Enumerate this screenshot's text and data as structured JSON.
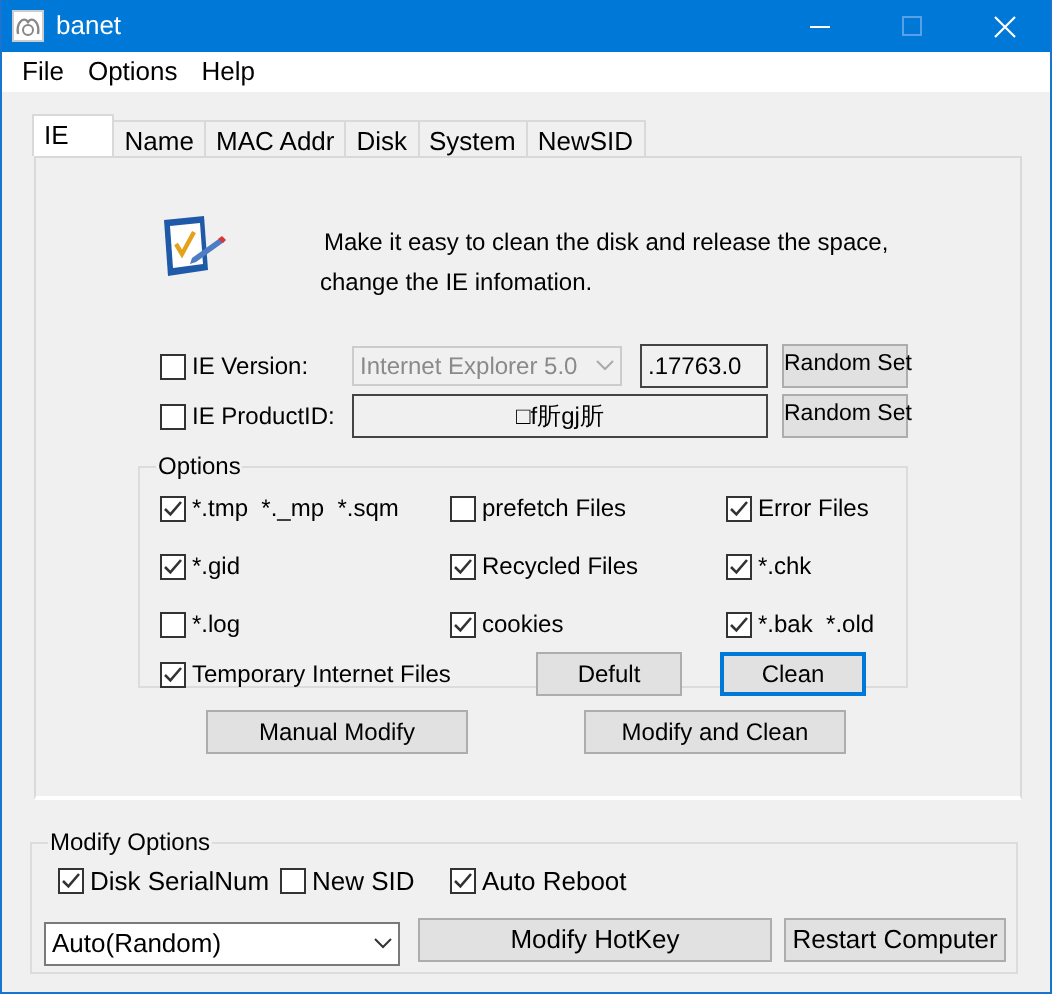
{
  "window": {
    "title": "banet"
  },
  "menu": [
    "File",
    "Options",
    "Help"
  ],
  "tabs": [
    {
      "label": "IE",
      "selected": true
    },
    {
      "label": "Name",
      "selected": false
    },
    {
      "label": "MAC Addr",
      "selected": false
    },
    {
      "label": "Disk",
      "selected": false
    },
    {
      "label": "System",
      "selected": false
    },
    {
      "label": "NewSID",
      "selected": false
    }
  ],
  "ie_panel": {
    "description": [
      "Make it easy to clean the disk and release the space,",
      "change the IE infomation."
    ],
    "ie_version": {
      "label": "IE Version:",
      "checked": false,
      "combo": {
        "value": "Internet Explorer 5.0",
        "disabled": true
      },
      "build": ".17763.0",
      "button": "Random Set"
    },
    "product_id": {
      "label": "IE ProductID:",
      "checked": false,
      "value": "□f肵gj肵",
      "button": "Random Set"
    },
    "options": {
      "title": "Options",
      "items": [
        {
          "label": "*.tmp  *._mp  *.sqm",
          "checked": true
        },
        {
          "label": "prefetch Files",
          "checked": false
        },
        {
          "label": "Error Files",
          "checked": true
        },
        {
          "label": "*.gid",
          "checked": true
        },
        {
          "label": "Recycled Files",
          "checked": true
        },
        {
          "label": "*.chk",
          "checked": true
        },
        {
          "label": "*.log",
          "checked": false
        },
        {
          "label": "cookies",
          "checked": true
        },
        {
          "label": "*.bak  *.old",
          "checked": true
        },
        {
          "label": "Temporary Internet Files",
          "checked": true
        }
      ],
      "buttons": [
        {
          "label": "Defult",
          "focused": false
        },
        {
          "label": "Clean",
          "focused": true
        }
      ]
    },
    "buttons": [
      "Manual Modify",
      "Modify and Clean"
    ]
  },
  "modify_options": {
    "title": "Modify Options",
    "checks": [
      {
        "label": "Disk SerialNum",
        "checked": true
      },
      {
        "label": "New SID",
        "checked": false
      },
      {
        "label": "Auto Reboot",
        "checked": true
      }
    ],
    "dropdown": "Auto(Random)",
    "buttons": [
      "Modify HotKey",
      "Restart Computer"
    ]
  }
}
